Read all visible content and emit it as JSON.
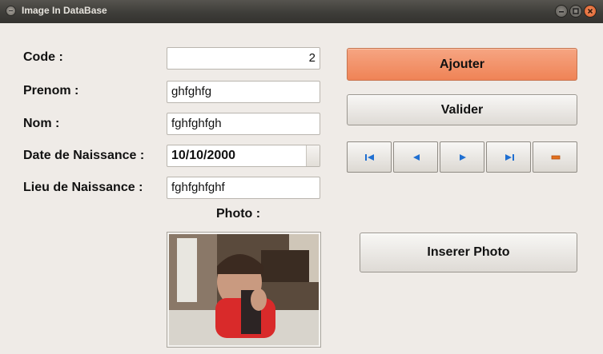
{
  "window": {
    "title": "Image In DataBase",
    "controls": {
      "minimize": "minimize-icon",
      "maximize": "maximize-icon",
      "close": "close-icon"
    }
  },
  "form": {
    "code": {
      "label": "Code :",
      "value": "2"
    },
    "prenom": {
      "label": "Prenom :",
      "value": "ghfghfg"
    },
    "nom": {
      "label": "Nom :",
      "value": "fghfghfgh"
    },
    "date_naissance": {
      "label": "Date de Naissance :",
      "value": "10/10/2000"
    },
    "lieu_naissance": {
      "label": "Lieu de Naissance :",
      "value": "fghfghfghf"
    },
    "photo": {
      "label": "Photo :"
    }
  },
  "buttons": {
    "ajouter": "Ajouter",
    "valider": "Valider",
    "inserer_photo": "Inserer Photo"
  },
  "navigation": [
    {
      "name": "first-record-icon"
    },
    {
      "name": "previous-record-icon"
    },
    {
      "name": "next-record-icon"
    },
    {
      "name": "last-record-icon"
    },
    {
      "name": "delete-record-icon"
    }
  ],
  "colors": {
    "titlebar": "#3e3d39",
    "window_bg": "#efebe7",
    "primary_button": "#ef8356",
    "nav_icon_blue": "#1f6fd1",
    "delete_icon": "#e2711d"
  }
}
